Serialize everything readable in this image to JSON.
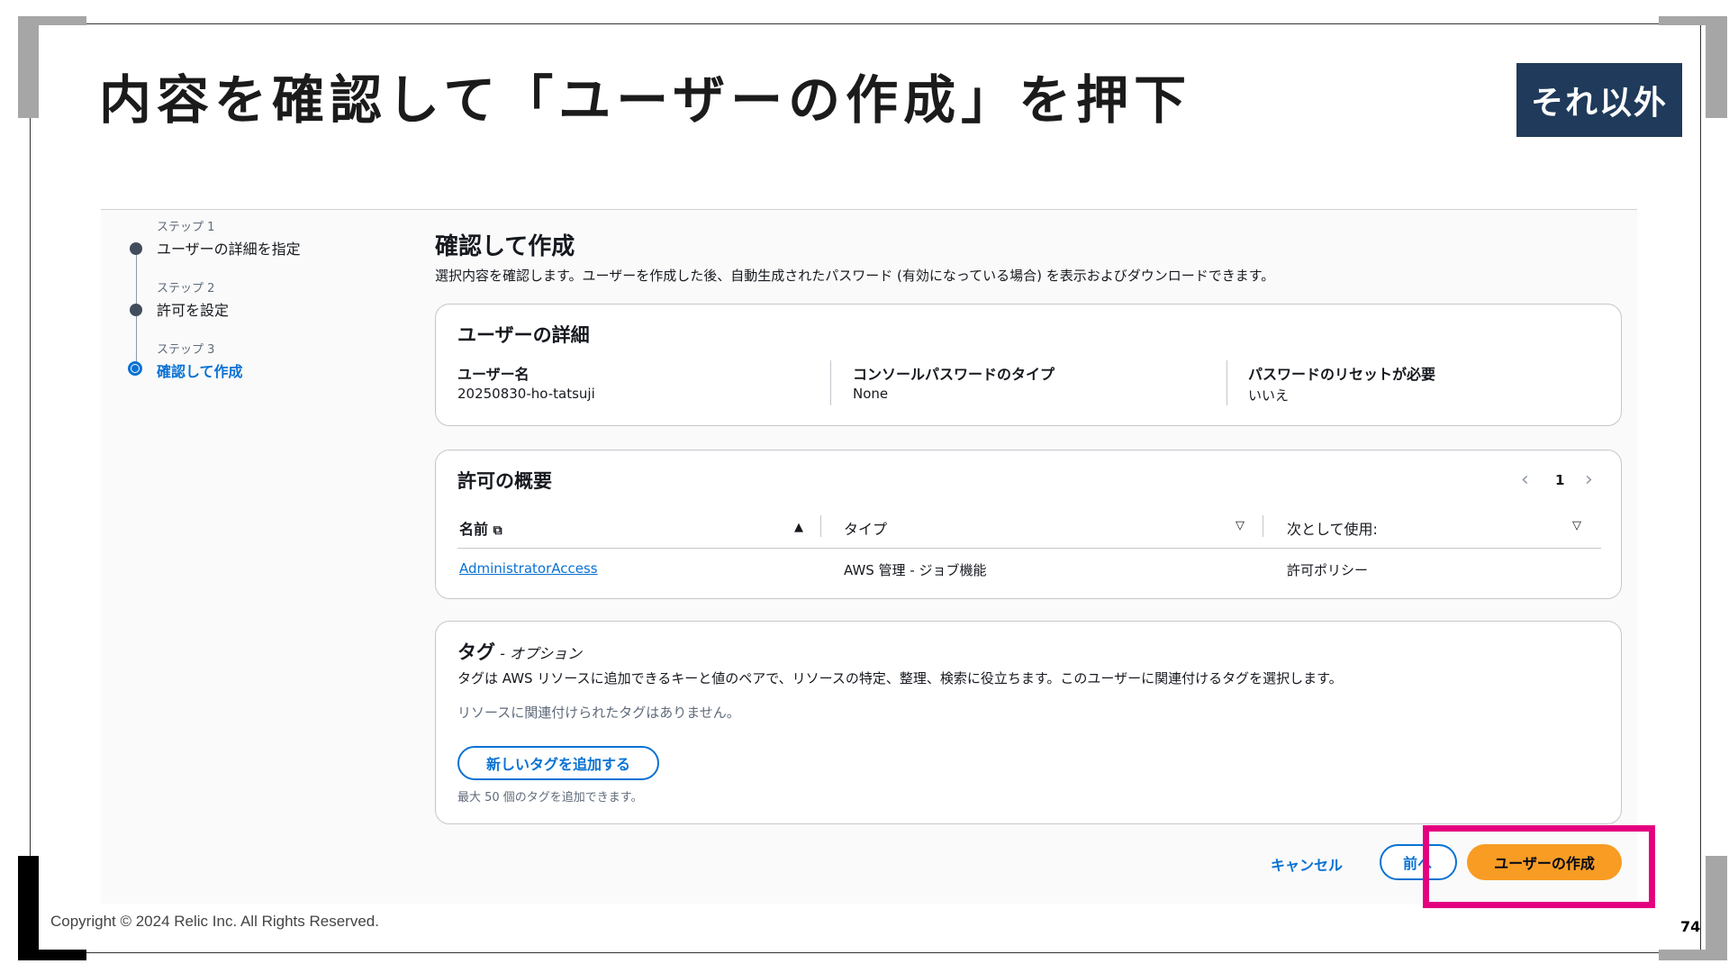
{
  "slide": {
    "title": "内容を確認して「ユーザーの作成」を押下",
    "badge": "それ以外",
    "copyright": "Copyright © 2024 Relic Inc. All Rights Reserved.",
    "page_number": "74"
  },
  "steps": [
    {
      "sub": "ステップ 1",
      "label": "ユーザーの詳細を指定",
      "active": false
    },
    {
      "sub": "ステップ 2",
      "label": "許可を設定",
      "active": false
    },
    {
      "sub": "ステップ 3",
      "label": "確認して作成",
      "active": true
    }
  ],
  "main": {
    "title": "確認して作成",
    "description": "選択内容を確認します。ユーザーを作成した後、自動生成されたパスワード (有効になっている場合) を表示およびダウンロードできます。"
  },
  "user_details": {
    "heading": "ユーザーの詳細",
    "fields": [
      {
        "key": "ユーザー名",
        "value": "20250830-ho-tatsuji"
      },
      {
        "key": "コンソールパスワードのタイプ",
        "value": "None"
      },
      {
        "key": "パスワードのリセットが必要",
        "value": "いいえ"
      }
    ]
  },
  "permissions": {
    "heading": "許可の概要",
    "page": "1",
    "columns": [
      "名前",
      "タイプ",
      "次として使用:"
    ],
    "rows": [
      {
        "name": "AdministratorAccess",
        "type": "AWS 管理 - ジョブ機能",
        "used_as": "許可ポリシー"
      }
    ]
  },
  "tags": {
    "heading": "タグ",
    "optional": "- オプション",
    "description": "タグは AWS リソースに追加できるキーと値のペアで、リソースの特定、整理、検索に役立ちます。このユーザーに関連付けるタグを選択します。",
    "empty": "リソースに関連付けられたタグはありません。",
    "add_button": "新しいタグを追加する",
    "limit": "最大 50 個のタグを追加できます。"
  },
  "actions": {
    "cancel": "キャンセル",
    "previous": "前へ",
    "create": "ユーザーの作成"
  },
  "colors": {
    "accent": "#0972d3",
    "primary_button": "#f89c24",
    "highlight": "#e4007f",
    "badge": "#1f3a5a"
  }
}
